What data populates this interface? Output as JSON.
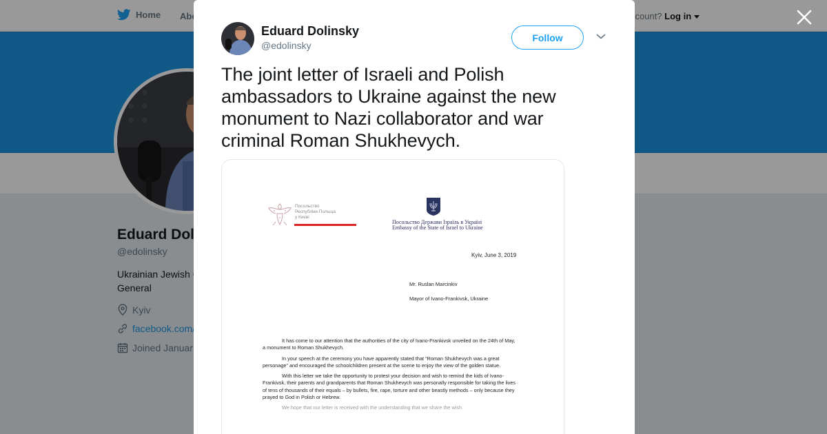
{
  "background": {
    "nav": {
      "home_label": "Home",
      "about_label": "Abo",
      "account_prefix": "ccount?",
      "login_label": "Log in"
    },
    "profile": {
      "name": "Eduard Dol",
      "handle": "@edolinsky",
      "bio_line1": "Ukrainian Jewish C",
      "bio_line2": "General",
      "location": "Kyiv",
      "link": "facebook.com/",
      "joined": "Joined Januar"
    }
  },
  "modal": {
    "author_name": "Eduard Dolinsky",
    "author_handle": "@edolinsky",
    "follow_label": "Follow",
    "tweet_text": "The joint letter of Israeli and Polish ambassadors to Ukraine against the new monument to Nazi collaborator and war criminal Roman Shukhevych.",
    "media": {
      "polish_header": [
        "Посольство",
        "Республіки Польща",
        "у Києві"
      ],
      "israel_header_1": "Посольство Держави Ізраїль в Україні",
      "israel_header_2": "Embassy of the State of Israel to Ukraine",
      "date": "Kyiv, June 3, 2019",
      "recipient_1": "Mr. Ruslan Marcinkiv",
      "recipient_2": "Mayor of Ivano-Frankivsk, Ukraine",
      "paragraphs": [
        "It has come to our attention that the authorities of the city of Ivano-Frankivsk unveiled on the 24th of May, a monument to Roman Shukhevych.",
        "In your speech at the ceremony you have apparently stated that “Roman Shukhevych was a great personage” and encouraged the schoolchildren present at the scene to enjoy the view of the golden statue.",
        "With this letter we take the opportunity to protest your decision and wish to remind the kids of Ivano-Frankivsk, their parents and grandparents that Roman Shukhevych was personally responsible for taking the lives of tens of thousands of their equals – by bullets, fire, rape, torture and other beastly methods – only because they prayed to God in Polish or Hebrew.",
        "We hope that our letter is received with the understanding that we share the wish"
      ]
    }
  },
  "colors": {
    "twitter_blue": "#1da1f2",
    "banner_blue": "#1b95e0",
    "overlay": "rgba(0,0,0,0.40)"
  }
}
